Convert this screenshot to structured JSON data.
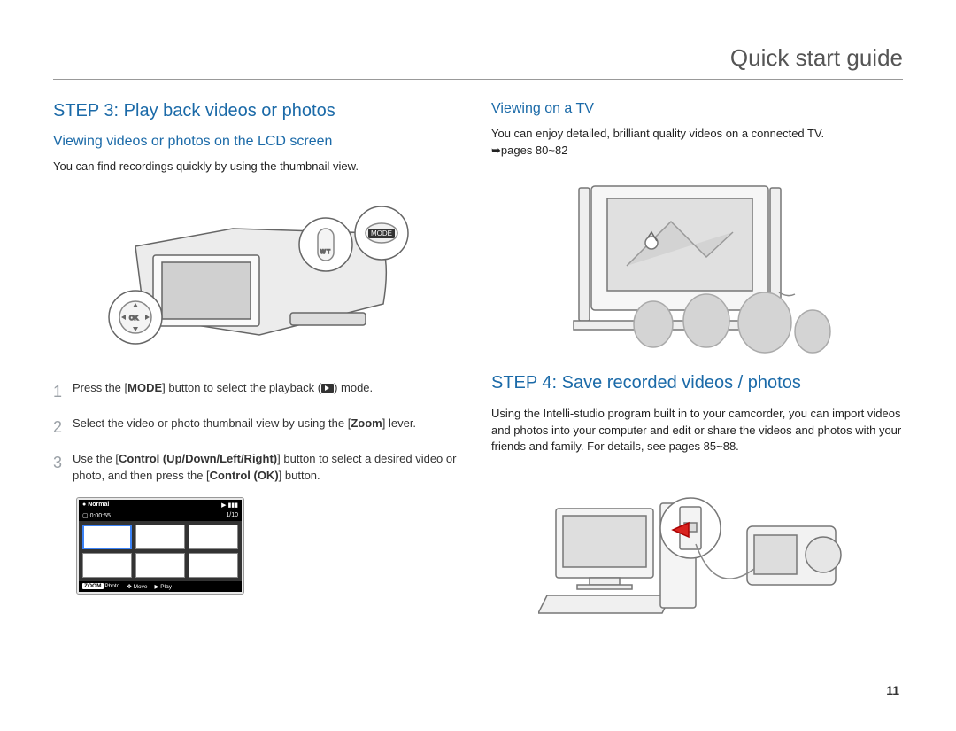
{
  "header": {
    "title": "Quick start guide"
  },
  "page_number": "11",
  "left": {
    "step_heading": "STEP 3: Play back videos or photos",
    "sub_heading": "Viewing videos or photos on the LCD screen",
    "intro": "You can find recordings quickly by using the thumbnail view.",
    "mode_label": "MODE",
    "steps": [
      {
        "num": "1",
        "pre": "Press the [",
        "bold1": "MODE",
        "mid": "] button to select the playback (",
        "after": ") mode."
      },
      {
        "num": "2",
        "pre": "Select the video or photo thumbnail view by using the [",
        "bold1": "Zoom",
        "mid": "] lever.",
        "after": ""
      },
      {
        "num": "3",
        "pre": "Use the [",
        "bold1": "Control (Up/Down/Left/Right)",
        "mid": "] button to select a desired video or photo, and then press the [",
        "bold2": "Control (OK)",
        "after": "] button."
      }
    ],
    "thumb": {
      "top_left_icon": "●",
      "top_left_label": "Normal",
      "top_right_icon": "▶ ▮▮▮",
      "row2_left": "0:00:55",
      "row2_right": "1/10",
      "bottom_zoom": "ZOOM",
      "bottom_photo": "Photo",
      "bottom_move_icon": "✥",
      "bottom_move": "Move",
      "bottom_play_icon": "▶",
      "bottom_play": "Play"
    }
  },
  "right": {
    "sub_heading": "Viewing on a TV",
    "intro_line1": "You can enjoy detailed, brilliant quality videos on a connected TV.",
    "intro_pages": "➥pages 80~82",
    "step_heading": "STEP 4: Save recorded videos / photos",
    "body": "Using the Intelli-studio program built in to your camcorder, you can import videos and photos into your computer and edit or share the videos and photos with your friends and family. For details, see pages 85~88."
  }
}
